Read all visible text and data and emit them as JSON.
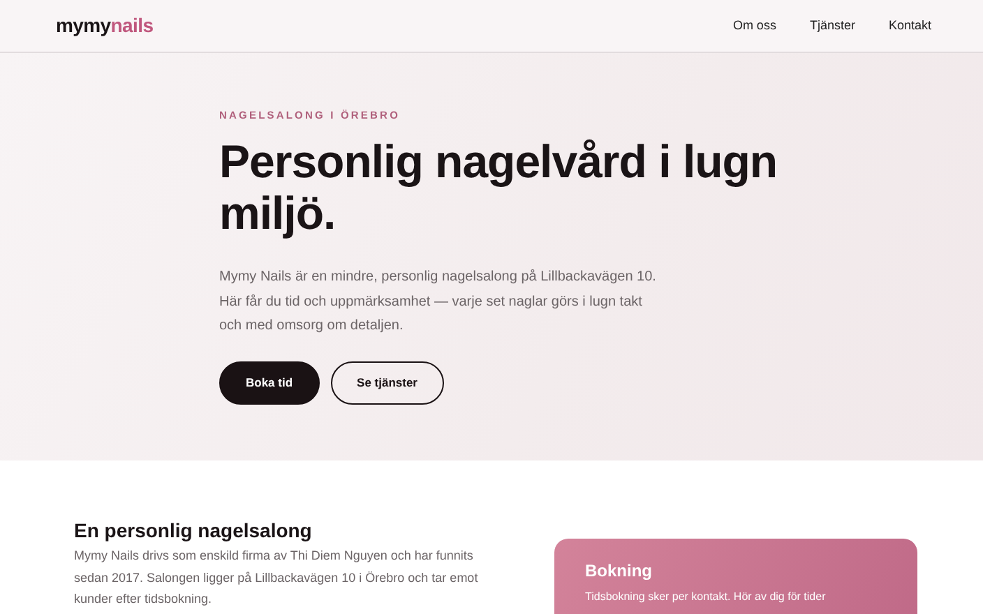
{
  "navbar": {
    "brand": {
      "first": "mymy",
      "second": "nails"
    },
    "links": [
      "Om oss",
      "Tjänster",
      "Kontakt"
    ]
  },
  "hero": {
    "eyebrow": "NAGELSALONG I ÖREBRO",
    "title": "Personlig nagelvård i lugn miljö.",
    "text": "Mymy Nails är en mindre, personlig nagelsalong på Lillbackavägen 10. Här får du tid och uppmärksamhet — varje set naglar görs i lugn takt och med omsorg om detaljen.",
    "buttons": [
      {
        "label": "Boka tid",
        "kind": "primary"
      },
      {
        "label": "Se tjänster",
        "kind": "outline"
      }
    ]
  },
  "about": {
    "title": "En personlig nagelsalong",
    "text": "Mymy Nails drivs som enskild firma av Thi Diem Nguyen och har funnits sedan 2017. Salongen ligger på Lillbackavägen 10 i Örebro och tar emot kunder efter tidsbokning."
  },
  "booking": {
    "title": "Bokning",
    "text": "Tidsbokning sker per kontakt. Hör av dig för tider"
  }
}
